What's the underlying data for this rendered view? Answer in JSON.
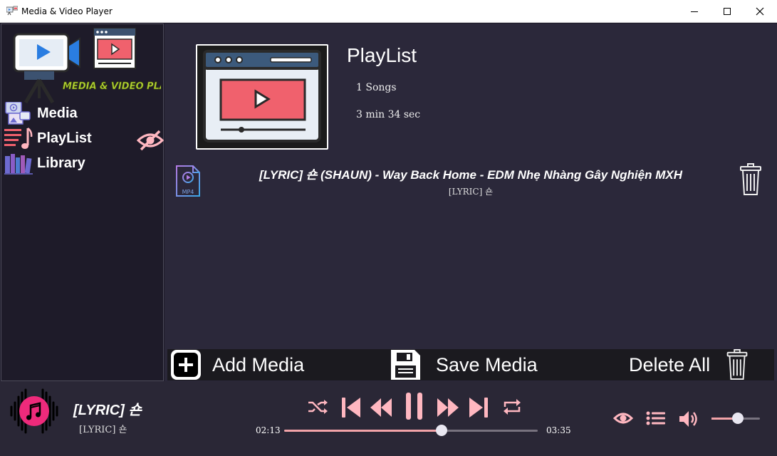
{
  "window": {
    "title": "Media & Video Player"
  },
  "logo": {
    "text": "MEDIA & VIDEO PLAYER"
  },
  "sidebar": {
    "items": [
      {
        "label": "Media"
      },
      {
        "label": "PlayList"
      },
      {
        "label": "Library"
      }
    ]
  },
  "playlist": {
    "title": "PlayList",
    "songs": "1 Songs",
    "duration": "3 min 34 sec",
    "tracks": [
      {
        "title": "[LYRIC] 숀 (SHAUN) - Way Back Home - EDM Nhẹ Nhàng Gây Nghiện MXH",
        "artist": "[LYRIC] 숀",
        "format": "MP4"
      }
    ]
  },
  "actions": {
    "add": "Add Media",
    "save": "Save Media",
    "delete_all": "Delete All"
  },
  "player": {
    "title": "[LYRIC] 숀",
    "artist": "[LYRIC] 숀",
    "elapsed": "02:13",
    "total": "03:35",
    "progress": 0.62,
    "volume": 0.55
  },
  "colors": {
    "accent": "#f2a3a8",
    "pink": "#ee2a7b",
    "background": "#2b283a",
    "sidebar": "#1e1b29"
  },
  "icons": [
    "app-icon",
    "media-icon",
    "playlist-icon",
    "library-icon",
    "eye-off-icon",
    "mp4-file-icon",
    "trash-icon",
    "plus-icon",
    "save-icon",
    "music-note-icon",
    "shuffle-icon",
    "skip-previous-icon",
    "rewind-icon",
    "pause-icon",
    "fast-forward-icon",
    "skip-next-icon",
    "repeat-icon",
    "eye-icon",
    "queue-list-icon",
    "volume-icon"
  ]
}
